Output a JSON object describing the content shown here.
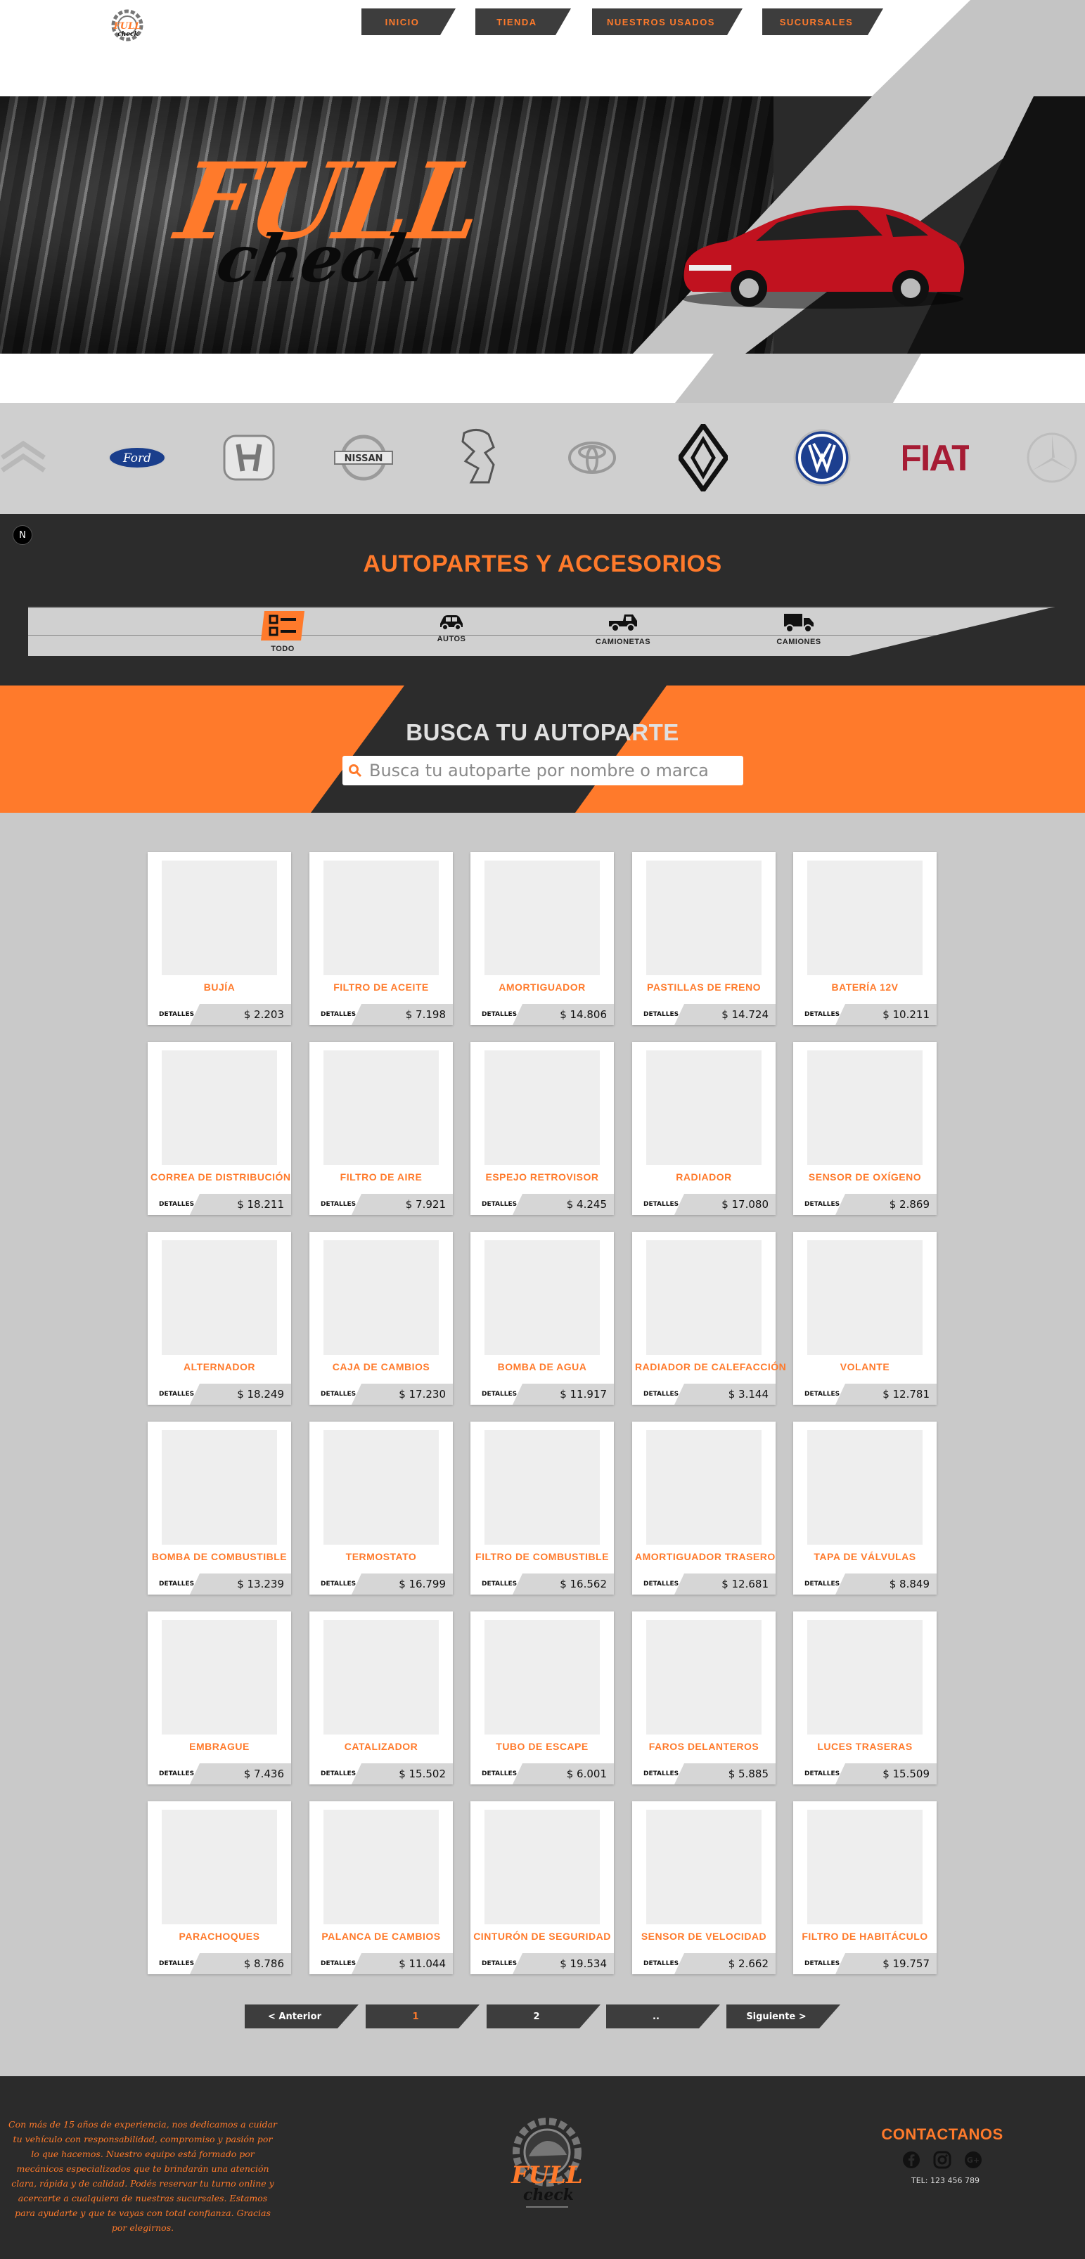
{
  "colors": {
    "accent": "#ff7a2b",
    "dark": "#2c2c2c",
    "grey": "#c9c9c9"
  },
  "header": {
    "logo": {
      "top": "FULL",
      "bottom": "check"
    },
    "nav": [
      {
        "label": "INICIO"
      },
      {
        "label": "TIENDA"
      },
      {
        "label": "NUESTROS USADOS"
      },
      {
        "label": "SUCURSALES"
      }
    ]
  },
  "hero": {
    "logo_top": "FULL",
    "logo_bottom": "check"
  },
  "brands": [
    "Citroën",
    "Ford",
    "Honda",
    "Nissan",
    "Peugeot",
    "Toyota",
    "Renault",
    "Volkswagen",
    "FIAT",
    "Mercedes-Benz"
  ],
  "categories": {
    "badge": "N",
    "title": "AUTOPARTES Y ACCESORIOS",
    "items": [
      {
        "label": "TODO",
        "icon": "list-icon",
        "active": true
      },
      {
        "label": "AUTOS",
        "icon": "car-icon",
        "active": false
      },
      {
        "label": "CAMIONETAS",
        "icon": "pickup-truck-icon",
        "active": false
      },
      {
        "label": "CAMIONES",
        "icon": "truck-icon",
        "active": false
      }
    ]
  },
  "search": {
    "title": "BUSCA TU AUTOPARTE",
    "placeholder": "Busca tu autoparte por nombre o marca"
  },
  "products": {
    "details_label": "DETALLES",
    "items": [
      {
        "name": "BUJÍA",
        "price": "$ 2.203"
      },
      {
        "name": "FILTRO DE ACEITE",
        "price": "$ 7.198"
      },
      {
        "name": "AMORTIGUADOR",
        "price": "$ 14.806"
      },
      {
        "name": "PASTILLAS DE FRENO",
        "price": "$ 14.724"
      },
      {
        "name": "BATERÍA 12V",
        "price": "$ 10.211"
      },
      {
        "name": "CORREA DE DISTRIBUCIÓN",
        "price": "$ 18.211"
      },
      {
        "name": "FILTRO DE AIRE",
        "price": "$ 7.921"
      },
      {
        "name": "ESPEJO RETROVISOR",
        "price": "$ 4.245"
      },
      {
        "name": "RADIADOR",
        "price": "$ 17.080"
      },
      {
        "name": "SENSOR DE OXÍGENO",
        "price": "$ 2.869"
      },
      {
        "name": "ALTERNADOR",
        "price": "$ 18.249"
      },
      {
        "name": "CAJA DE CAMBIOS",
        "price": "$ 17.230"
      },
      {
        "name": "BOMBA DE AGUA",
        "price": "$ 11.917"
      },
      {
        "name": "RADIADOR DE CALEFACCIÓN",
        "price": "$ 3.144"
      },
      {
        "name": "VOLANTE",
        "price": "$ 12.781"
      },
      {
        "name": "BOMBA DE COMBUSTIBLE",
        "price": "$ 13.239"
      },
      {
        "name": "TERMOSTATO",
        "price": "$ 16.799"
      },
      {
        "name": "FILTRO DE COMBUSTIBLE",
        "price": "$ 16.562"
      },
      {
        "name": "AMORTIGUADOR TRASERO",
        "price": "$ 12.681"
      },
      {
        "name": "TAPA DE VÁLVULAS",
        "price": "$ 8.849"
      },
      {
        "name": "EMBRAGUE",
        "price": "$ 7.436"
      },
      {
        "name": "CATALIZADOR",
        "price": "$ 15.502"
      },
      {
        "name": "TUBO DE ESCAPE",
        "price": "$ 6.001"
      },
      {
        "name": "FAROS DELANTEROS",
        "price": "$ 5.885"
      },
      {
        "name": "LUCES TRASERAS",
        "price": "$ 15.509"
      },
      {
        "name": "PARACHOQUES",
        "price": "$ 8.786"
      },
      {
        "name": "PALANCA DE CAMBIOS",
        "price": "$ 11.044"
      },
      {
        "name": "CINTURÓN DE SEGURIDAD",
        "price": "$ 19.534"
      },
      {
        "name": "SENSOR DE VELOCIDAD",
        "price": "$ 2.662"
      },
      {
        "name": "FILTRO DE HABITÁCULO",
        "price": "$ 19.757"
      }
    ]
  },
  "pagination": {
    "prev": "< Anterior",
    "pages": [
      "1",
      "2",
      ".."
    ],
    "current": "1",
    "next": "Siguiente >"
  },
  "footer": {
    "about": "Con más de 15 años de experiencia, nos dedicamos a cuidar tu vehículo con responsabilidad, compromiso y pasión por lo que hacemos. Nuestro equipo está formado por mecánicos especializados que te brindarán una atención clara, rápida y de calidad. Podés reservar tu turno online y acercarte a cualquiera de nuestras sucursales. Estamos para ayudarte y que te vayas con total confianza. Gracias por elegirnos.",
    "logo": {
      "top": "FULL",
      "bottom": "check"
    },
    "contact_title": "CONTACTANOS",
    "social": [
      "facebook-icon",
      "instagram-icon",
      "google-plus-icon"
    ],
    "phone": "TEL: 123 456 789"
  }
}
